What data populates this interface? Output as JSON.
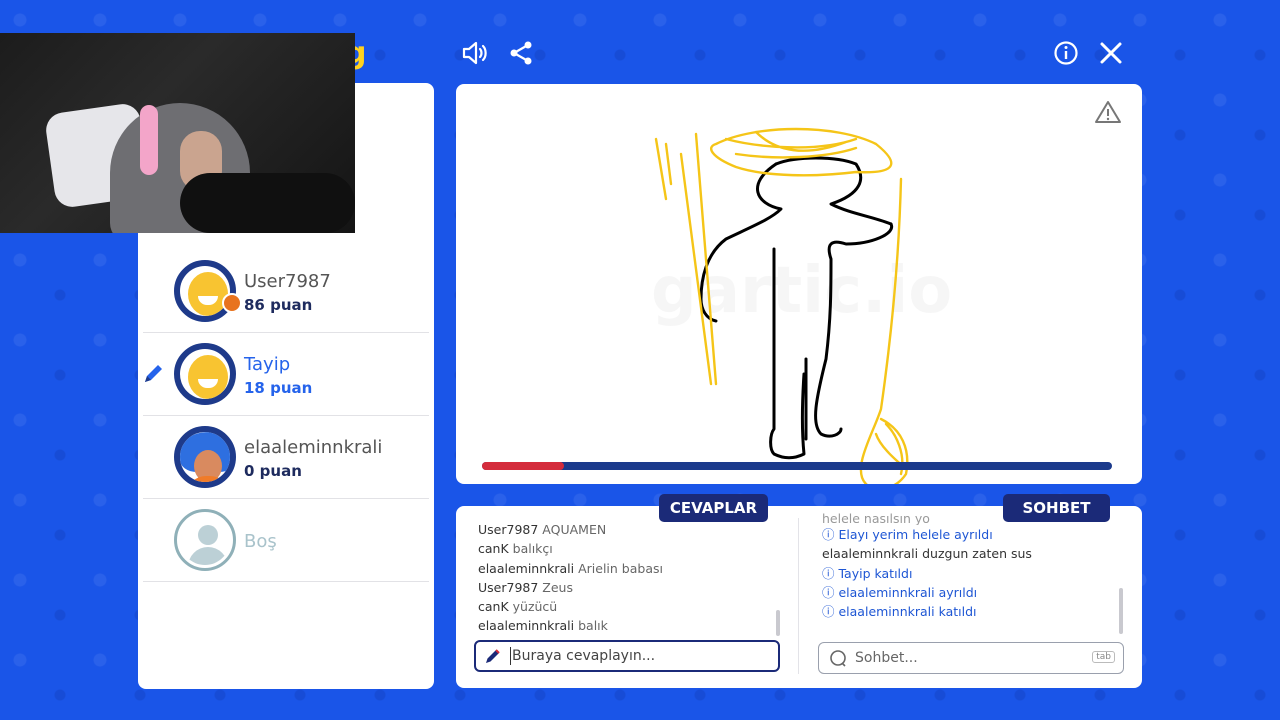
{
  "topbar": {
    "sound_icon": "speaker-icon",
    "share_icon": "share-icon",
    "info_icon": "info-icon",
    "close_icon": "close-icon"
  },
  "players": [
    {
      "name": "User7987",
      "points": "86 puan",
      "avatar": "yellow-smiley",
      "drawing": false
    },
    {
      "name": "Tayip",
      "points": "18 puan",
      "avatar": "yellow-smiley",
      "drawing": true
    },
    {
      "name": "elaaleminnkrali",
      "points": "0 puan",
      "avatar": "curly-hair",
      "drawing": false
    },
    {
      "name": "Boş",
      "points": "",
      "avatar": "empty",
      "drawing": false
    }
  ],
  "round_progress": 0.13,
  "labels": {
    "answers": "CEVAPLAR",
    "chat": "SOHBET"
  },
  "answers": [
    {
      "user": "User7987",
      "text": "AQUAMEN"
    },
    {
      "user": "canK",
      "text": "balıkçı"
    },
    {
      "user": "elaaleminnkrali",
      "text": "Arielin babası"
    },
    {
      "user": "User7987",
      "text": "Zeus"
    },
    {
      "user": "canK",
      "text": "yüzücü"
    },
    {
      "user": "elaaleminnkrali",
      "text": "balık"
    }
  ],
  "chat": {
    "faded": "helele nasılsın yo",
    "lines": [
      {
        "type": "sys",
        "user": "Elayı yerim helele",
        "text": "ayrıldı"
      },
      {
        "type": "msg",
        "user": "elaaleminnkrali",
        "text": "duzgun zaten sus"
      },
      {
        "type": "sys",
        "user": "Tayip",
        "text": "katıldı"
      },
      {
        "type": "sys",
        "user": "elaaleminnkrali",
        "text": "ayrıldı"
      },
      {
        "type": "sys",
        "user": "elaaleminnkrali",
        "text": "katıldı"
      }
    ]
  },
  "inputs": {
    "answer_placeholder": "Buraya cevaplayın...",
    "chat_placeholder": "Sohbet...",
    "tab_hint": "tab"
  },
  "colors": {
    "background": "#1a55e8",
    "panel_dark": "#1b2a78",
    "drawer_blue": "#2563eb",
    "progress_red": "#d42c3c",
    "sketch_yellow": "#f5c518"
  }
}
